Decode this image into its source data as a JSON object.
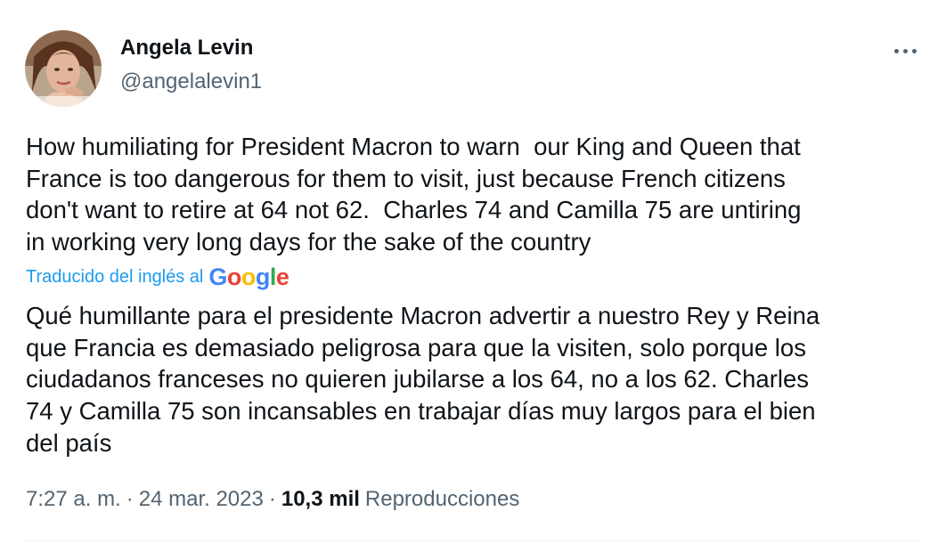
{
  "author": {
    "name": "Angela Levin",
    "handle": "@angelalevin1"
  },
  "tweet": {
    "text": "How humiliating for President Macron to warn  our King and Queen that\nFrance is too dangerous for them to visit, just because French citizens\ndon't want to retire at 64 not 62.  Charles 74 and Camilla 75 are untiring\nin working very long days for the sake of the country",
    "translated_label": "Traducido del inglés al",
    "translator_logo": "Google",
    "translated_text": "Qué humillante para el presidente Macron advertir a nuestro Rey y Reina\nque Francia es demasiado peligrosa para que la visiten, solo porque los\nciudadanos franceses no quieren jubilarse a los 64, no a los 62. Charles\n74 y Camilla 75 son incansables en trabajar días muy largos para el bien\ndel país"
  },
  "meta": {
    "time": "7:27 a. m.",
    "separator": "·",
    "date": "24 mar. 2023",
    "views_count": "10,3 mil",
    "views_label": "Reproducciones"
  },
  "icons": {
    "more": "more-horizontal-icon",
    "avatar": "profile-photo"
  },
  "colors": {
    "link_blue": "#1d9bf0",
    "secondary_text": "#536471",
    "primary_text": "#0f1419",
    "google_blue": "#4285F4",
    "google_red": "#EA4335",
    "google_yellow": "#FBBC05",
    "google_green": "#34A853"
  }
}
